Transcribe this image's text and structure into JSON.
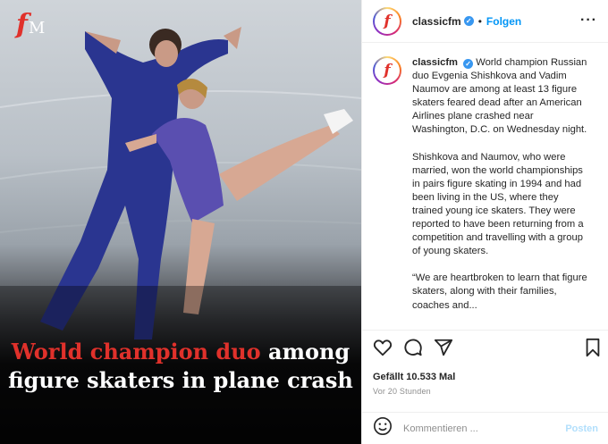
{
  "media": {
    "logo_letter": "f",
    "logo_suffix": "M",
    "headline_red": "World champion duo",
    "headline_rest_1": " among",
    "headline_line2": "figure skaters in plane crash"
  },
  "header": {
    "username": "classicfm",
    "separator": "•",
    "follow_label": "Folgen",
    "more_label": "···"
  },
  "caption": {
    "username": "classicfm",
    "paragraph_1": "World champion Russian duo Evgenia Shishkova and Vadim Naumov are among at least 13 figure skaters feared dead after an American Airlines plane crashed near Washington, D.C. on Wednesday night.",
    "paragraph_2": "Shishkova and Naumov, who were married, won the world championships in pairs figure skating in 1994 and had been living in the US, where they trained young ice skaters. They were reported to have been returning from a competition and travelling with a group of young skaters.",
    "paragraph_3": "“We are heartbroken to learn that figure skaters, along with their families, coaches and..."
  },
  "actions": {
    "likes": "Gefällt 10.533 Mal",
    "time": "Vor 20 Stunden"
  },
  "comment_box": {
    "placeholder": "Kommentieren ...",
    "post_label": "Posten"
  },
  "colors": {
    "accent_blue": "#0095f6",
    "verified_blue": "#3897f0",
    "brand_red": "#e0312b"
  },
  "icons": [
    "emoji-icon",
    "heart-icon",
    "comment-icon",
    "share-icon",
    "bookmark-icon",
    "verified-icon",
    "more-icon"
  ]
}
